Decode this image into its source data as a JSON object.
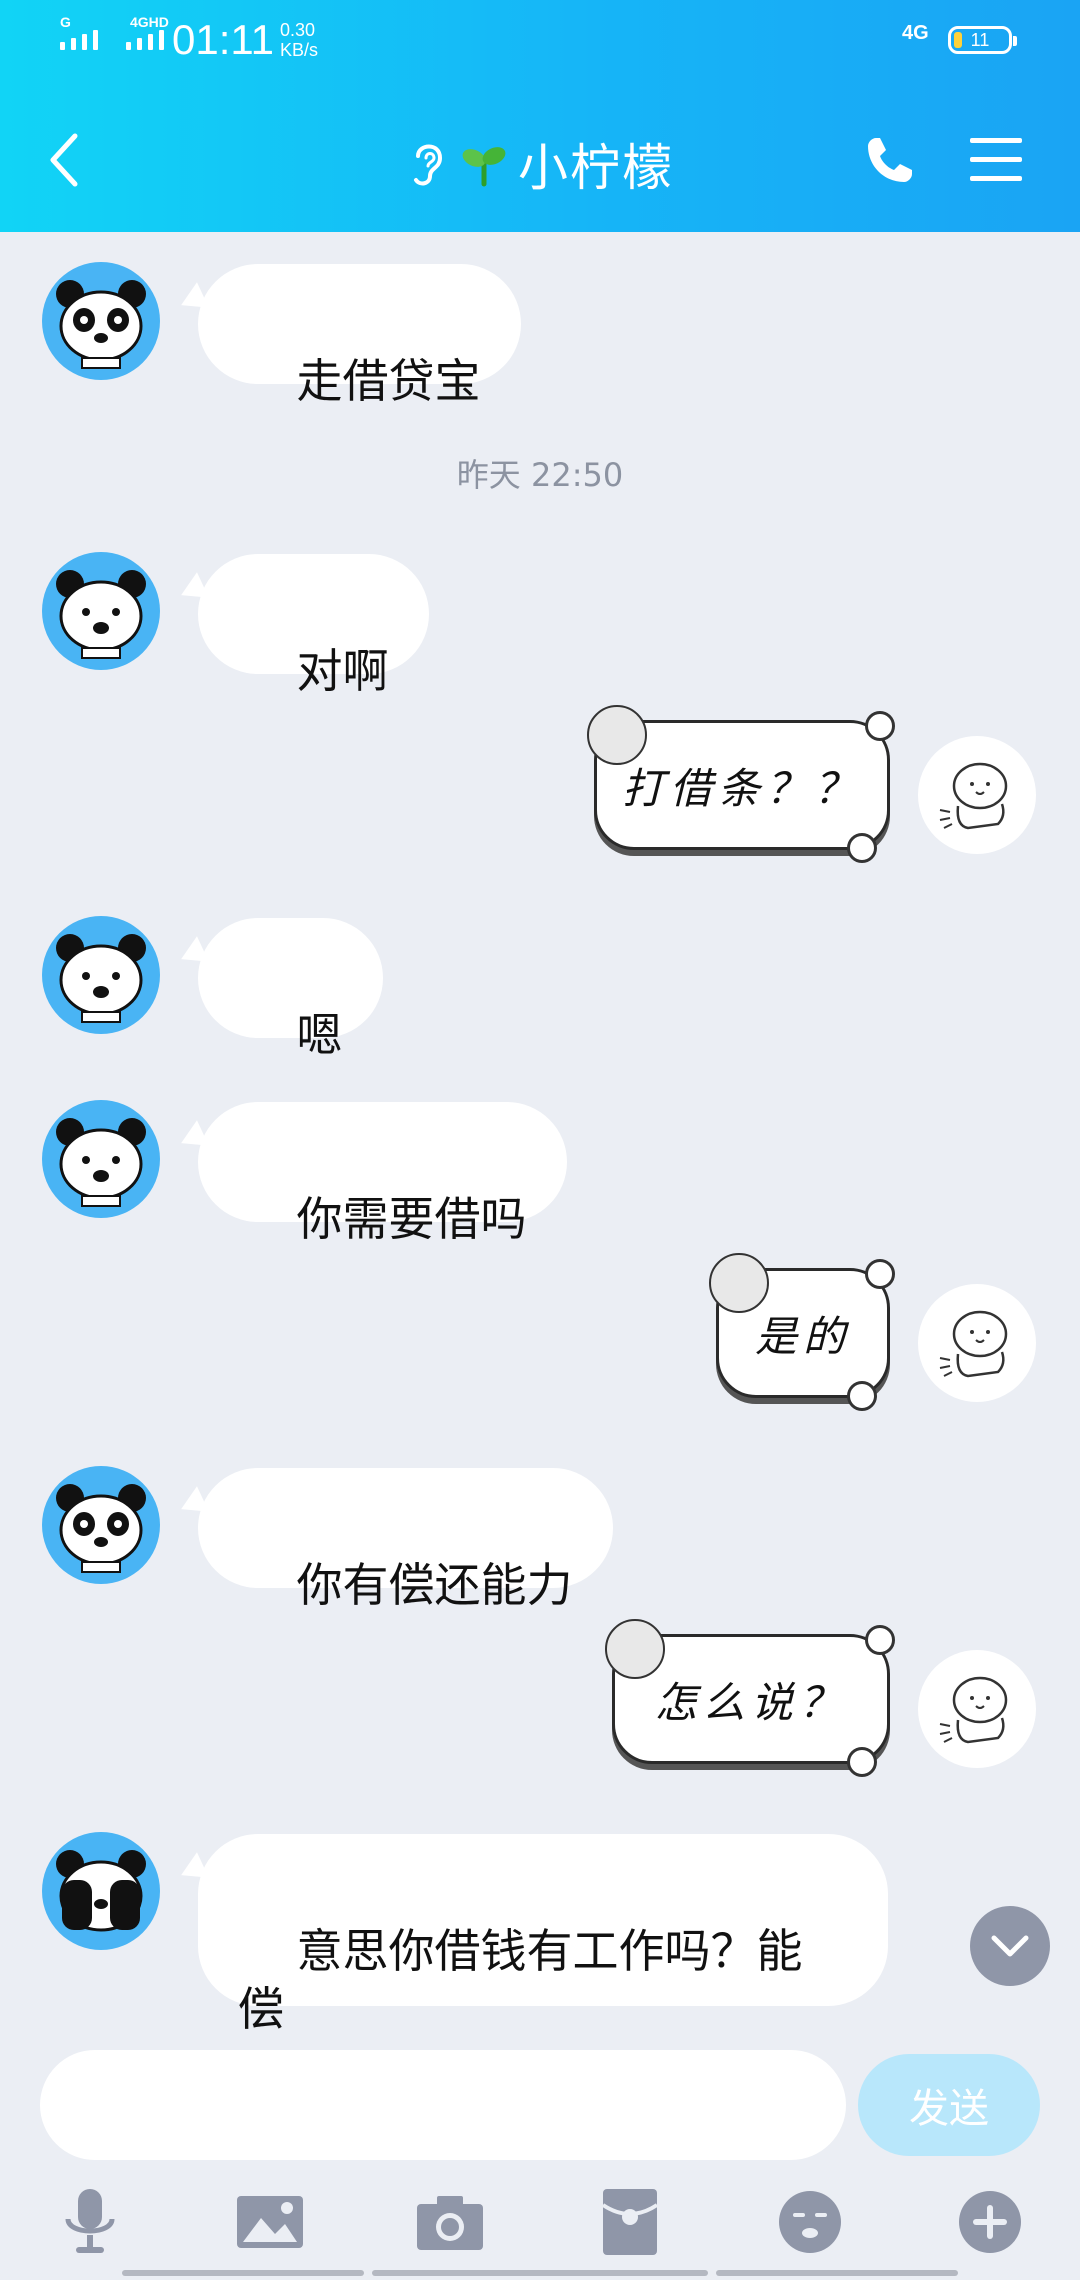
{
  "status_bar": {
    "signal_tag_1": "G",
    "signal_tag_2": "4GHD",
    "time": "01:11",
    "speed_value": "0.30",
    "speed_unit": "KB/s",
    "network": "4G",
    "battery": "11"
  },
  "header": {
    "title": "小柠檬"
  },
  "messages": [
    {
      "side": "left",
      "text": "走借贷宝"
    },
    {
      "side": "center",
      "text": "昨天 22:50"
    },
    {
      "side": "left",
      "text": "对啊"
    },
    {
      "side": "right",
      "sticker_text": "打借条？？"
    },
    {
      "side": "left",
      "text": "嗯"
    },
    {
      "side": "left",
      "text": "你需要借吗"
    },
    {
      "side": "right",
      "sticker_text": "是的"
    },
    {
      "side": "left",
      "text": "你有偿还能力"
    },
    {
      "side": "right",
      "sticker_text": "怎么说？"
    },
    {
      "side": "left",
      "text": "意思你借钱有工作吗？能偿\n还起吗"
    }
  ],
  "input": {
    "value": "",
    "send_label": "发送"
  },
  "colors": {
    "header_start": "#11d4f6",
    "header_end": "#1aa4f4",
    "chat_background": "#ebeef4",
    "avatar_background": "#49b4f4",
    "send_button": "#b8e7fb",
    "toolbar_icon": "#8f96a8"
  },
  "icons": {
    "back": "chevron-left-icon",
    "ear": "ear-icon",
    "sprout": "sprout-icon",
    "phone": "phone-icon",
    "menu": "menu-icon",
    "scroll_down": "chevron-down-icon",
    "voice": "microphone-icon",
    "image": "image-icon",
    "camera": "camera-icon",
    "red_packet": "red-packet-icon",
    "emoji": "emoji-icon",
    "plus": "plus-icon"
  }
}
